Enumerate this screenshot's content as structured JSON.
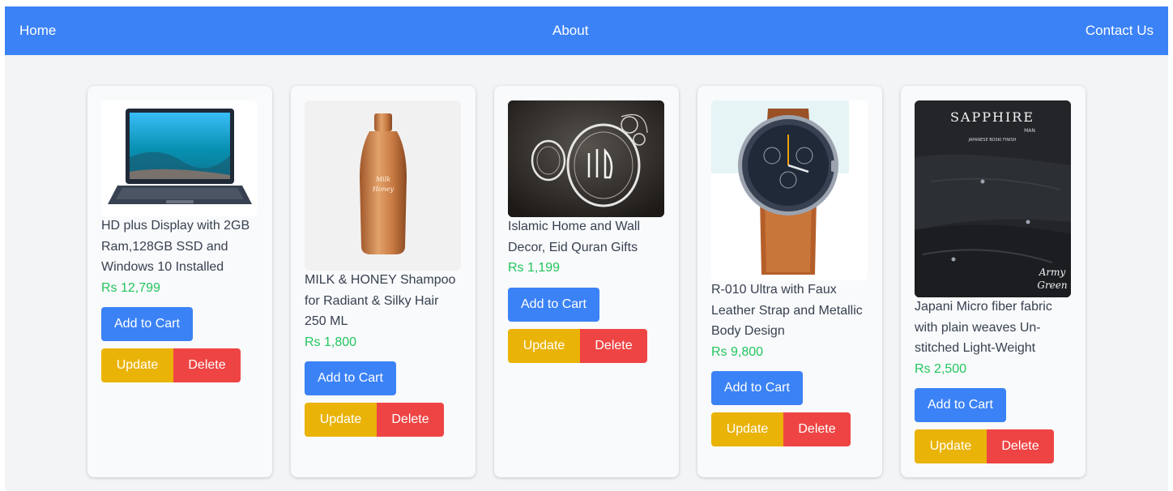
{
  "nav": {
    "home": "Home",
    "about": "About",
    "contact": "Contact Us"
  },
  "buttons": {
    "add_to_cart": "Add to Cart",
    "update": "Update",
    "delete": "Delete"
  },
  "products": [
    {
      "title": "HD plus Display with 2GB Ram,128GB SSD and Windows 10 Installed",
      "price": "Rs 12,799",
      "image": "laptop"
    },
    {
      "title": "MILK & HONEY Shampoo for Radiant & Silky Hair 250 ML",
      "price": "Rs 1,800",
      "image": "shampoo-bottle"
    },
    {
      "title": "Islamic Home and Wall Decor, Eid Quran Gifts",
      "price": "Rs 1,199",
      "image": "islamic-wall-decor"
    },
    {
      "title": "R-010 Ultra with Faux Leather Strap and Metallic Body Design",
      "price": "Rs 9,800",
      "image": "wristwatch"
    },
    {
      "title": "Japani Micro fiber fabric with plain weaves Un-stitched Light-Weight",
      "price": "Rs 2,500",
      "image": "fabric",
      "image_text": {
        "brand": "SAPPHIRE",
        "sub": "MAN",
        "finish": "JAPANESE BOSKI FINISH",
        "color1": "Army",
        "color2": "Green"
      }
    }
  ],
  "colors": {
    "navbar": "#3b82f6",
    "price": "#22c55e",
    "add_to_cart": "#3b82f6",
    "update": "#eab308",
    "delete": "#ef4444"
  }
}
